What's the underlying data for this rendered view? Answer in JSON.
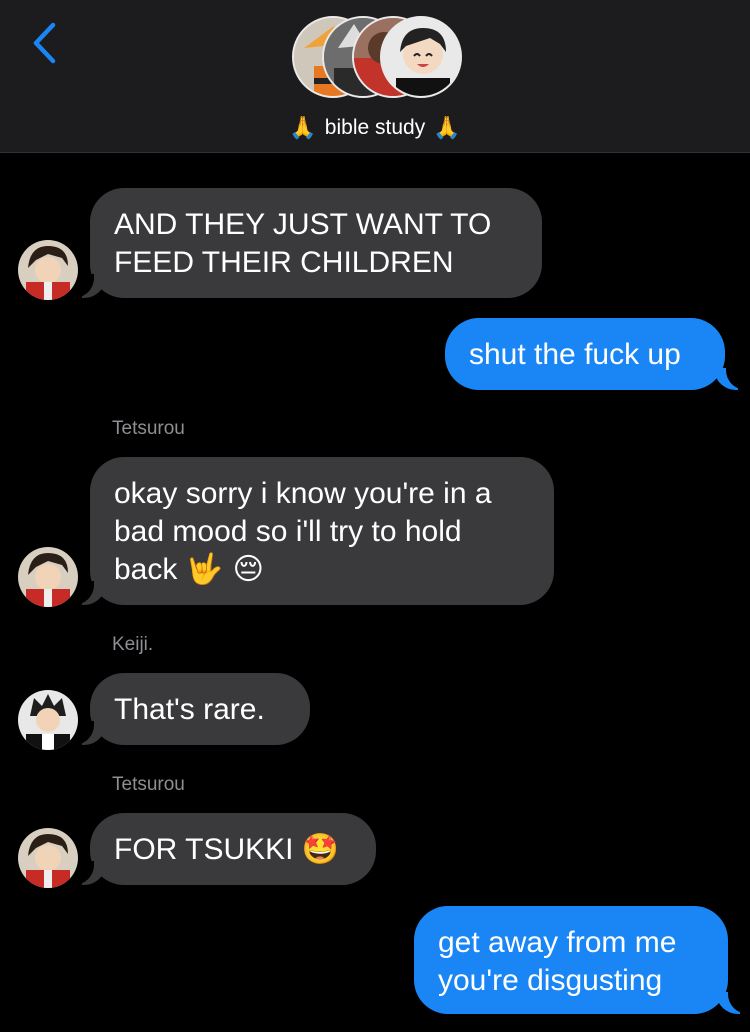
{
  "header": {
    "title": "bible study",
    "title_prefix_emoji": "🙏",
    "title_suffix_emoji": "🙏",
    "back_icon": "chevron-left-icon",
    "accent_color": "#1a86f5"
  },
  "messages": [
    {
      "sender": "",
      "text_line1": "AND THEY JUST WANT TO",
      "text_line2": "FEED THEIR CHILDREN"
    },
    {
      "text": "shut the fuck up"
    },
    {
      "sender": "Tetsurou",
      "text_line1": "okay sorry i know you're in a",
      "text_line2": "bad mood so i'll try to hold",
      "text_line3": "back",
      "emoji": "🤟 😔"
    },
    {
      "sender": "Keiji.",
      "text": "That's rare."
    },
    {
      "sender": "Tetsurou",
      "text": "FOR TSUKKI",
      "emoji": "🤩"
    },
    {
      "text_line1": "get away from me",
      "text_line2": "you're disgusting"
    }
  ]
}
